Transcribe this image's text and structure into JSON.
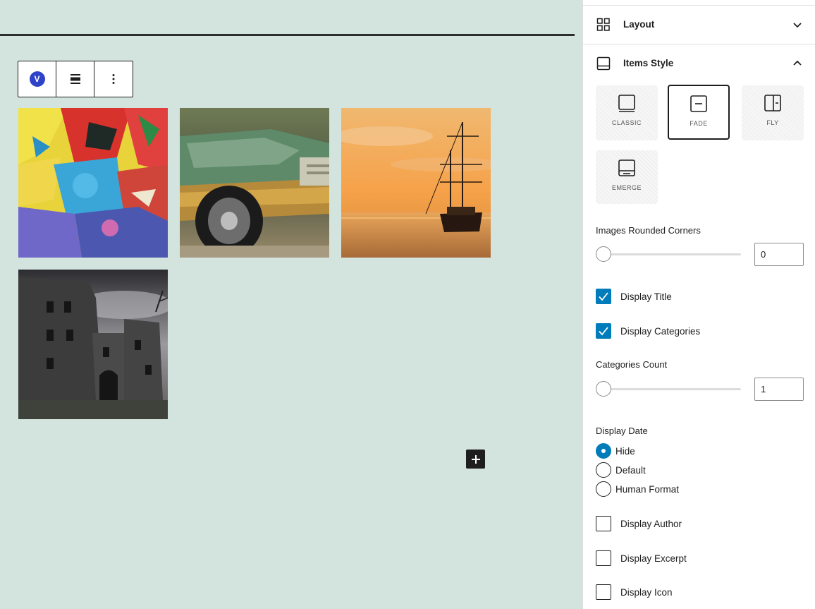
{
  "block_toolbar": {
    "block_icon": "V",
    "align_icon": "align-icon",
    "more_icon": "more-vertical-icon"
  },
  "gallery": {
    "items": [
      {
        "name": "graffiti-image",
        "alt": ""
      },
      {
        "name": "vintage-car-image",
        "alt": ""
      },
      {
        "name": "sailing-ship-image",
        "alt": ""
      },
      {
        "name": "castle-ruins-image",
        "alt": ""
      }
    ],
    "inserter_icon": "plus-icon"
  },
  "sidebar": {
    "layout_panel": {
      "title": "Layout",
      "icon": "grid-icon",
      "expanded": false
    },
    "items_style_panel": {
      "title": "Items Style",
      "icon": "card-icon",
      "expanded": true
    },
    "style_options": [
      {
        "label": "CLASSIC",
        "selected": false
      },
      {
        "label": "FADE",
        "selected": true
      },
      {
        "label": "FLY",
        "selected": false
      },
      {
        "label": "EMERGE",
        "selected": false
      }
    ],
    "rounded_corners": {
      "label": "Images Rounded Corners",
      "value": "0"
    },
    "display_title": {
      "label": "Display Title",
      "checked": true
    },
    "display_categories": {
      "label": "Display Categories",
      "checked": true
    },
    "categories_count": {
      "label": "Categories Count",
      "value": "1"
    },
    "display_date": {
      "label": "Display Date",
      "options": [
        {
          "label": "Hide",
          "selected": true
        },
        {
          "label": "Default",
          "selected": false
        },
        {
          "label": "Human Format",
          "selected": false
        }
      ]
    },
    "display_author": {
      "label": "Display Author",
      "checked": false
    },
    "display_excerpt": {
      "label": "Display Excerpt",
      "checked": false
    },
    "display_icon": {
      "label": "Display Icon",
      "checked": false
    }
  },
  "colors": {
    "canvas_bg": "#d3e4de",
    "accent": "#007cba",
    "brand": "#2f43c9",
    "dark": "#1e1e1e"
  }
}
